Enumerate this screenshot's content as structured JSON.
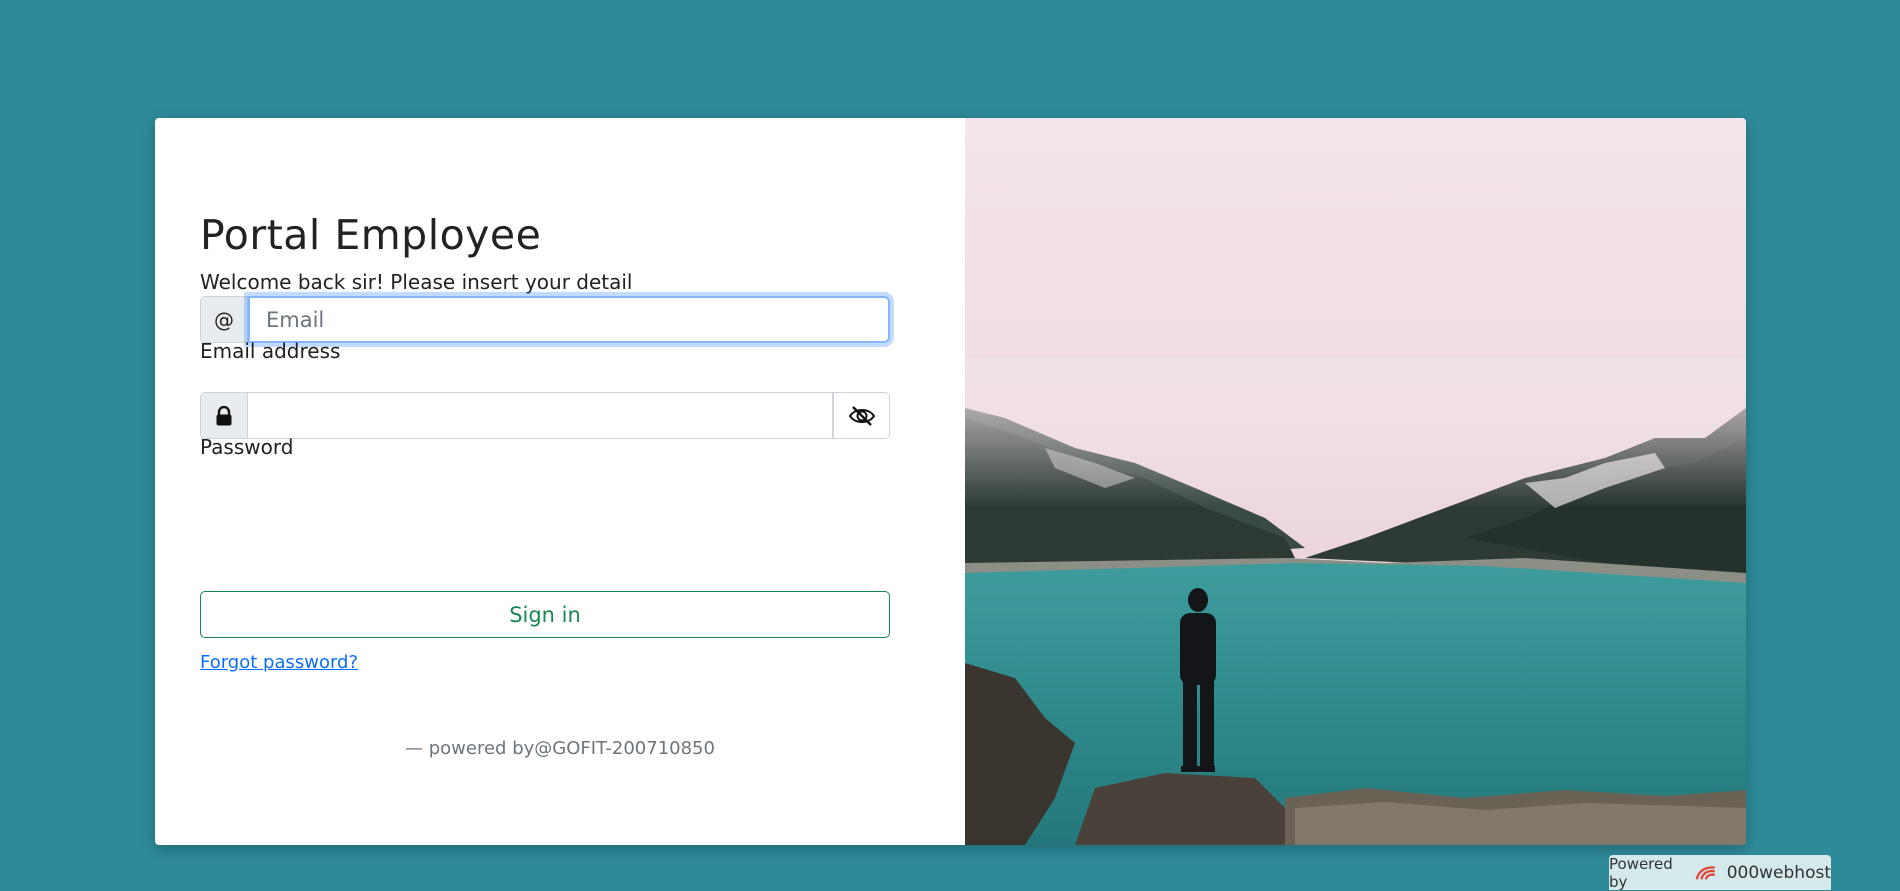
{
  "login": {
    "title": "Portal Employee",
    "subtitle": "Welcome back sir! Please insert your detail",
    "email_addon": "@",
    "email_placeholder": "Email",
    "email_label": "Email address",
    "password_label": "Password",
    "signin_label": "Sign in",
    "forgot_label": "Forgot password?",
    "footer_text": "— powered by@GOFIT-200710850"
  },
  "hosting_badge": {
    "prefix": "Powered by",
    "brand": "000webhost"
  },
  "icons": {
    "email_addon": "at-sign",
    "password_addon": "lock-icon",
    "password_toggle": "eye-slash-icon",
    "hero": "mountain-lake-photo",
    "badge_logo": "000webhost-logo-icon"
  },
  "colors": {
    "background": "#2e8a99",
    "sign_in": "#198754",
    "link": "#0d6efd",
    "focus_ring": "#86b7fe"
  }
}
